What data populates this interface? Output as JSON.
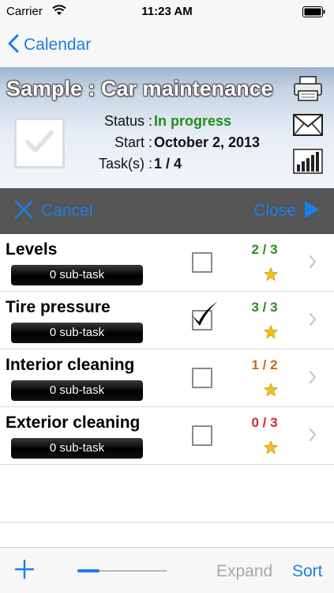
{
  "status_bar": {
    "carrier": "Carrier",
    "time": "11:23 AM"
  },
  "nav": {
    "back_label": "Calendar"
  },
  "header": {
    "title": "Sample : Car maintenance",
    "status_label": "Status :",
    "status_value": "In progress",
    "start_label": "Start :",
    "start_value": "October 2, 2013",
    "tasks_label": "Task(s) :",
    "tasks_value": "1 / 4"
  },
  "actions": {
    "cancel_label": "Cancel",
    "close_label": "Close"
  },
  "tasks": [
    {
      "title": "Levels",
      "subtasks": "0 sub-task",
      "checked": false,
      "count": "2 / 3",
      "count_color": "#2a8a1e"
    },
    {
      "title": "Tire pressure",
      "subtasks": "0 sub-task",
      "checked": true,
      "count": "3 / 3",
      "count_color": "#2a8a1e"
    },
    {
      "title": "Interior cleaning",
      "subtasks": "0 sub-task",
      "checked": false,
      "count": "1 / 2",
      "count_color": "#c5681a"
    },
    {
      "title": "Exterior cleaning",
      "subtasks": "0 sub-task",
      "checked": false,
      "count": "0 / 3",
      "count_color": "#d3262b"
    }
  ],
  "toolbar": {
    "slider_value": 0.25,
    "expand_label": "Expand",
    "sort_label": "Sort"
  },
  "colors": {
    "accent": "#1a7fe8",
    "green": "#2a8a1e",
    "orange": "#c5681a",
    "red": "#d3262b",
    "star": "#f2c21b"
  }
}
